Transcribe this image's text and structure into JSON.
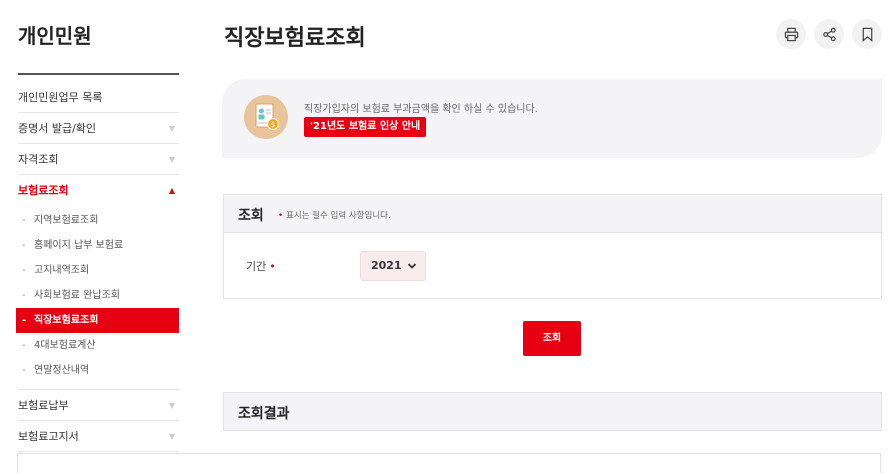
{
  "sidebar": {
    "title": "개인민원",
    "items": [
      {
        "label": "개인민원업무 목록",
        "arrow": ""
      },
      {
        "label": "증명서 발급/확인",
        "arrow": "▼"
      },
      {
        "label": "자격조회",
        "arrow": "▼"
      },
      {
        "label": "보험료조회",
        "arrow": "▲"
      },
      {
        "label": "보험료납부",
        "arrow": "▼"
      },
      {
        "label": "보험료고지서",
        "arrow": "▼"
      }
    ],
    "subitems": [
      {
        "label": "지역보험료조회"
      },
      {
        "label": "홈페이지 납부 보험료"
      },
      {
        "label": "고지내역조회"
      },
      {
        "label": "사회보험료 완납조회"
      },
      {
        "label": "직장보험료조회"
      },
      {
        "label": "4대보험료계산"
      },
      {
        "label": "연말정산내역"
      }
    ],
    "dash": "-"
  },
  "header": {
    "title": "직장보험료조회",
    "tools": [
      "print-icon",
      "share-icon",
      "bookmark-icon"
    ]
  },
  "info": {
    "text": "직장가입자의 보험료 부과금액을 확인 하실 수 있습니다.",
    "link": "'21년도 보험료 인상 안내"
  },
  "search": {
    "title": "조회",
    "note_dot": "•",
    "note": "표시는 필수 입력 사항입니다.",
    "field_label": "기간",
    "required_mark": "•",
    "year": "2021",
    "submit": "조회"
  },
  "result": {
    "title": "조회결과"
  },
  "colors": {
    "accent": "#e60012",
    "panel_bg": "#f4f4f6"
  }
}
